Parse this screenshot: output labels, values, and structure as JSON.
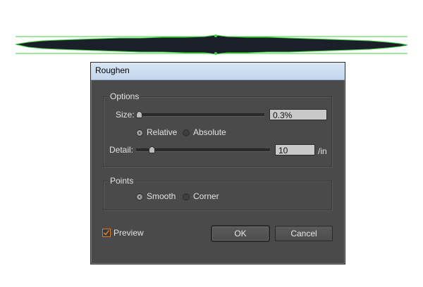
{
  "dialog": {
    "title": "Roughen",
    "options_group": "Options",
    "size_label": "Size:",
    "size_value": "0.3%",
    "size_fraction": 0.0,
    "relative_label": "Relative",
    "absolute_label": "Absolute",
    "selected_mode": "Relative",
    "detail_label": "Detail:",
    "detail_value": "10",
    "detail_unit": "/in",
    "detail_fraction": 0.1,
    "points_group": "Points",
    "smooth_label": "Smooth",
    "corner_label": "Corner",
    "selected_points": "Smooth",
    "preview_label": "Preview",
    "preview_checked": true,
    "ok_label": "OK",
    "cancel_label": "Cancel"
  },
  "colors": {
    "dialog_bg": "#4a4a4a",
    "titlebar": "#c9dbef",
    "shape_fill": "#1b1f2a",
    "selection_outline": "#3fd23f",
    "checkbox_accent": "#d8792c"
  }
}
